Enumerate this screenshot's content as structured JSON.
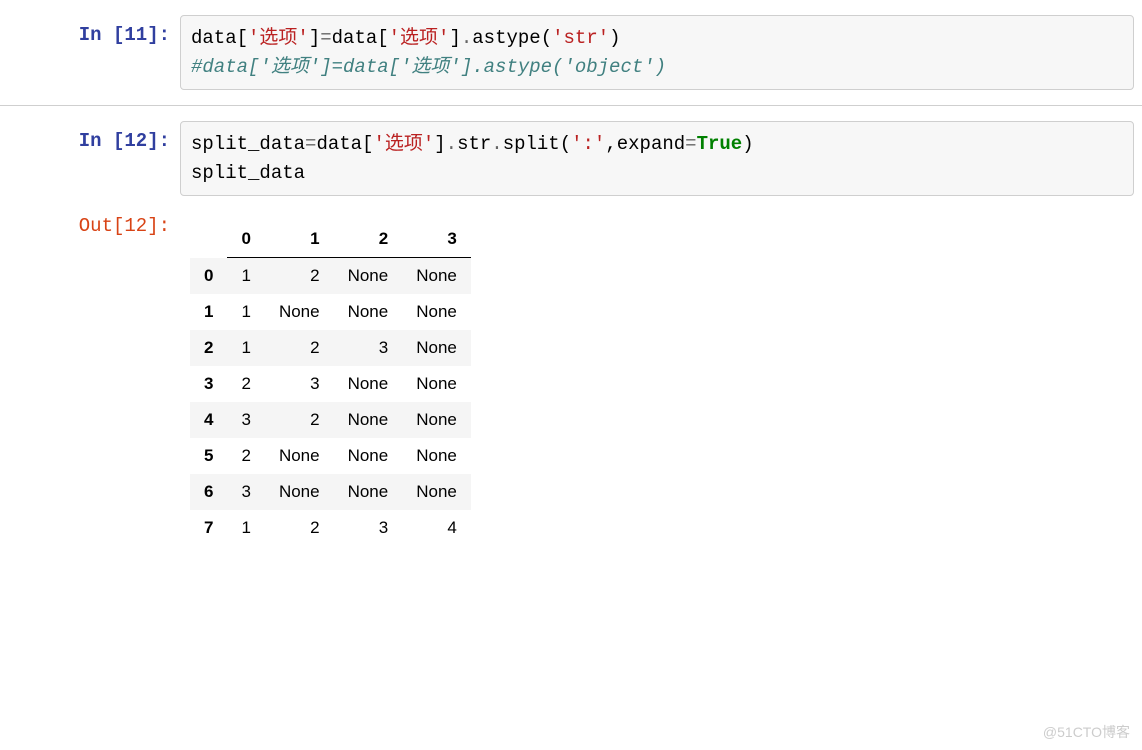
{
  "cells": {
    "cell11": {
      "prompt_label": "In [11]:",
      "code": {
        "line1": {
          "t1": "data[",
          "t2": "'选项'",
          "t3": "]",
          "t4": "=",
          "t5": "data[",
          "t6": "'选项'",
          "t7": "]",
          "t8": ".",
          "t9": "astype(",
          "t10": "'str'",
          "t11": ")"
        },
        "line2": "#data['选项']=data['选项'].astype('object')"
      }
    },
    "cell12": {
      "prompt_label": "In [12]:",
      "code": {
        "line1": {
          "t1": "split_data",
          "t2": "=",
          "t3": "data[",
          "t4": "'选项'",
          "t5": "]",
          "t6": ".",
          "t7": "str",
          "t8": ".",
          "t9": "split(",
          "t10": "':'",
          "t11": ",expand",
          "t12": "=",
          "t13": "True",
          "t14": ")"
        },
        "line2": "split_data"
      },
      "out_label": "Out[12]:"
    }
  },
  "table": {
    "columns": [
      "0",
      "1",
      "2",
      "3"
    ],
    "index": [
      "0",
      "1",
      "2",
      "3",
      "4",
      "5",
      "6",
      "7"
    ],
    "rows": [
      [
        "1",
        "2",
        "None",
        "None"
      ],
      [
        "1",
        "None",
        "None",
        "None"
      ],
      [
        "1",
        "2",
        "3",
        "None"
      ],
      [
        "2",
        "3",
        "None",
        "None"
      ],
      [
        "3",
        "2",
        "None",
        "None"
      ],
      [
        "2",
        "None",
        "None",
        "None"
      ],
      [
        "3",
        "None",
        "None",
        "None"
      ],
      [
        "1",
        "2",
        "3",
        "4"
      ]
    ]
  },
  "watermark": "@51CTO博客"
}
